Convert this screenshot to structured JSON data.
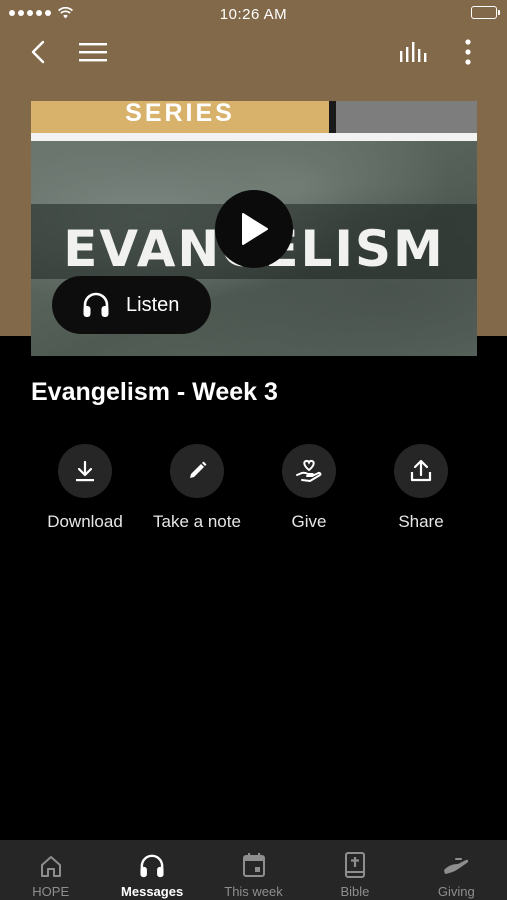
{
  "status_bar": {
    "time": "10:26 AM"
  },
  "nav": {
    "back_icon": "chevron-left-icon",
    "menu_icon": "hamburger-icon",
    "stats_icon": "audio-bars-icon",
    "more_icon": "vertical-dots-icon"
  },
  "artwork": {
    "series_label": "SERIES",
    "title": "EVANGELISM",
    "listen_label": "Listen"
  },
  "message": {
    "title": "Evangelism - Week 3"
  },
  "actions": [
    {
      "label": "Download",
      "icon": "download-icon"
    },
    {
      "label": "Take a note",
      "icon": "pencil-icon"
    },
    {
      "label": "Give",
      "icon": "giving-hand-heart-icon"
    },
    {
      "label": "Share",
      "icon": "share-icon"
    }
  ],
  "tabs": [
    {
      "label": "HOPE",
      "icon": "home-icon",
      "active": false
    },
    {
      "label": "Messages",
      "icon": "headphones-icon",
      "active": true
    },
    {
      "label": "This week",
      "icon": "calendar-icon",
      "active": false
    },
    {
      "label": "Bible",
      "icon": "bible-icon",
      "active": false
    },
    {
      "label": "Giving",
      "icon": "giving-icon",
      "active": false
    }
  ],
  "colors": {
    "header_background": "#81694a",
    "page_background": "#000000",
    "tabbar_background": "#262626",
    "series_banner": "#d8b26a"
  }
}
